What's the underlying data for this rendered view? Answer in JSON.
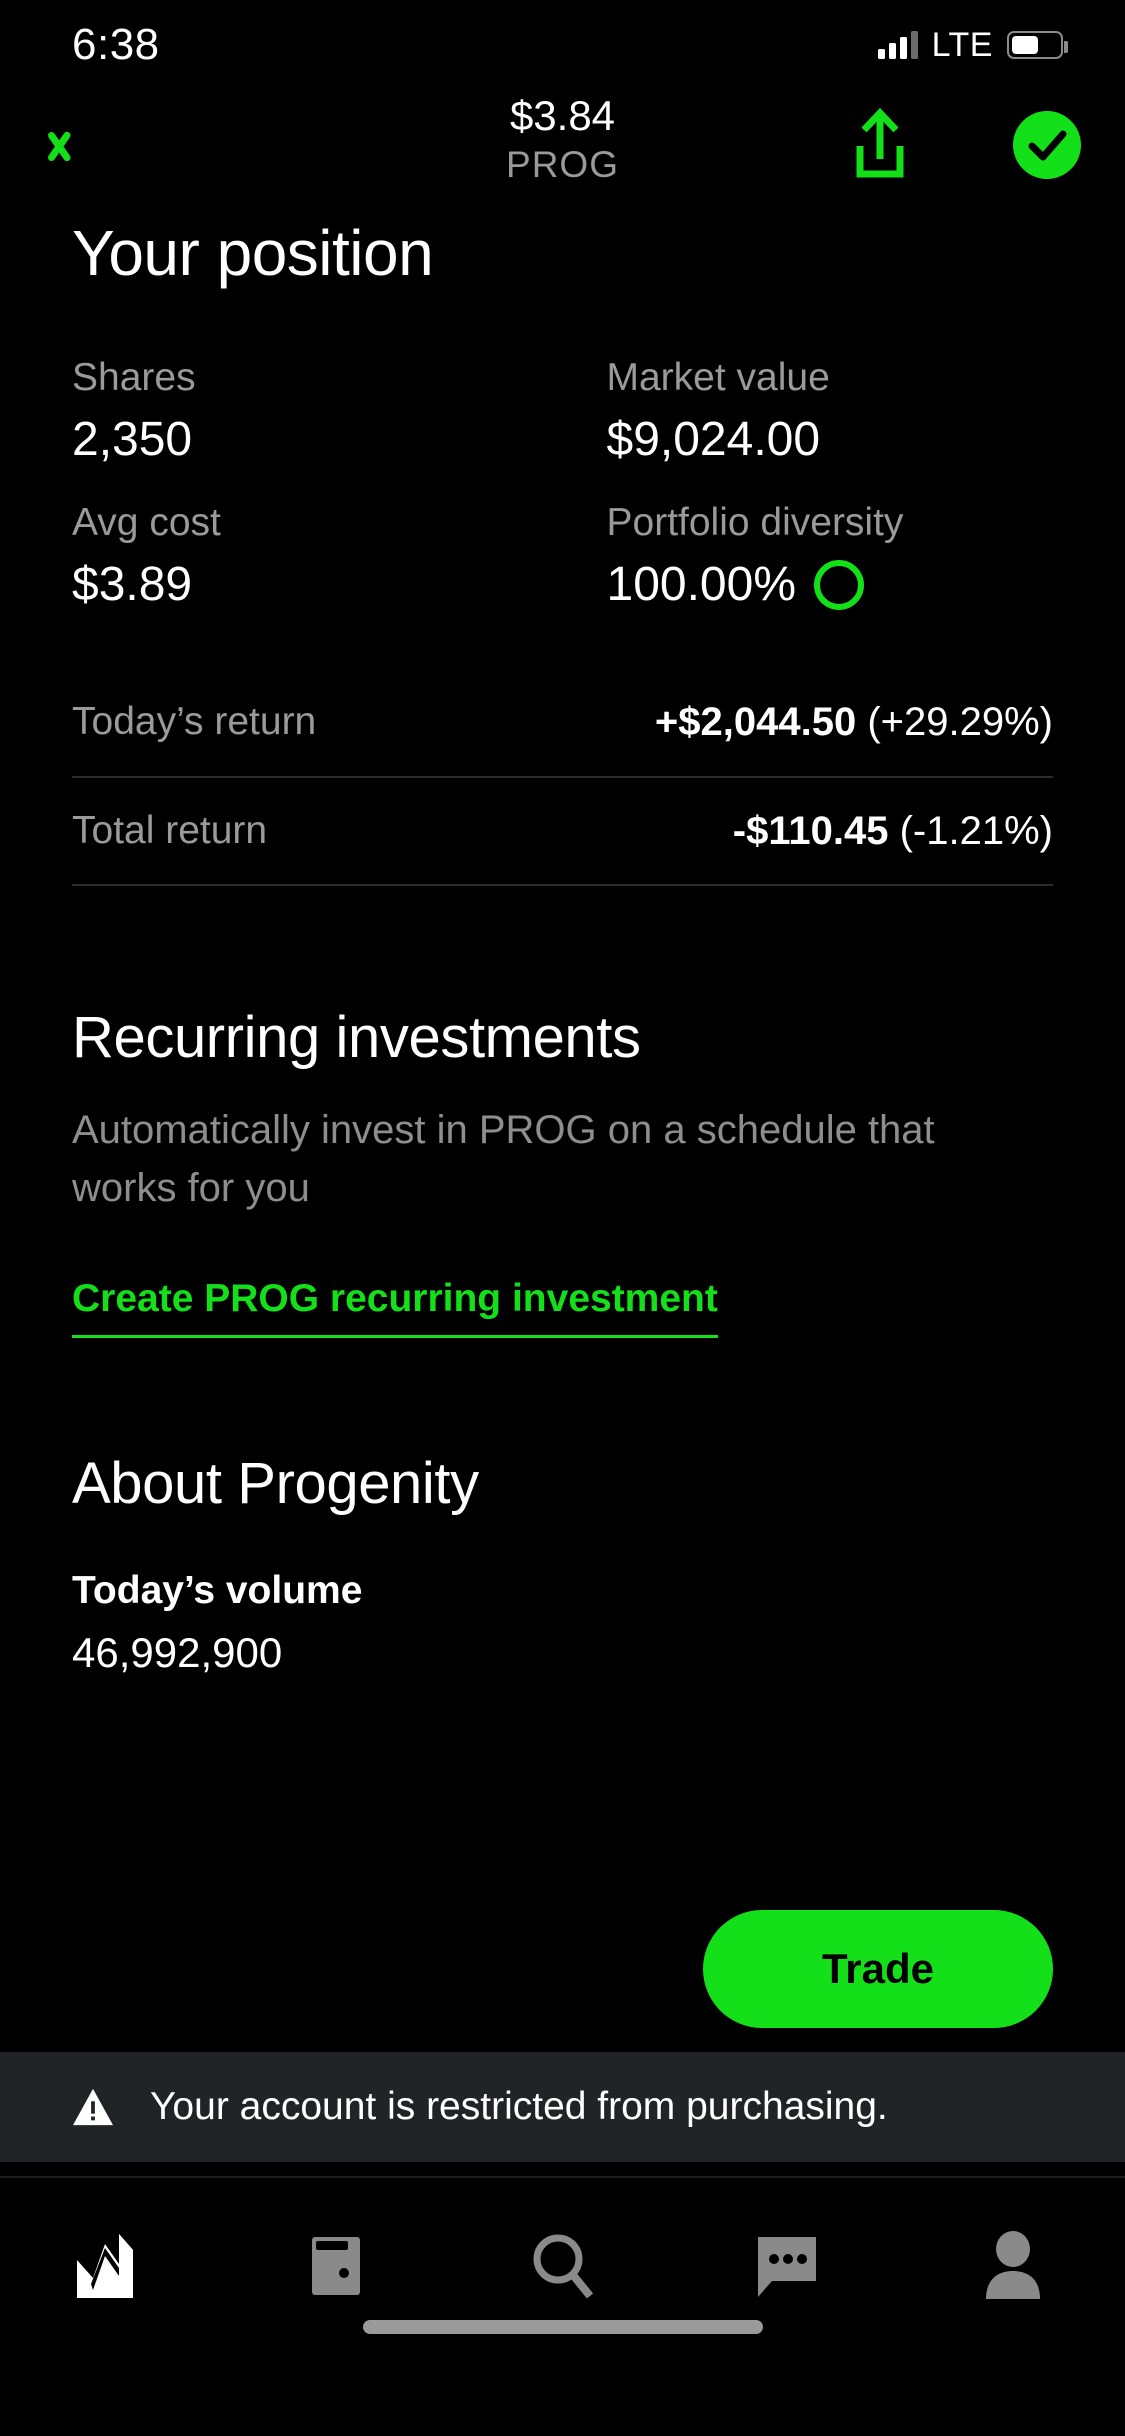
{
  "status_bar": {
    "time": "6:38",
    "network": "LTE",
    "signal_icon": "signal-bars-icon",
    "battery_icon": "battery-icon"
  },
  "nav_bar": {
    "back_icon": "chevron-left-icon",
    "price": "$3.84",
    "ticker": "PROG",
    "share_icon": "share-upload-icon",
    "status_icon": "check-circle-icon",
    "accent_color": "#14e01a"
  },
  "position": {
    "title": "Your position",
    "stats": [
      {
        "label": "Shares",
        "value": "2,350"
      },
      {
        "label": "Market value",
        "value": "$9,024.00"
      },
      {
        "label": "Avg cost",
        "value": "$3.89"
      },
      {
        "label": "Portfolio diversity",
        "value": "100.00%",
        "icon": "diversity-ring-icon"
      }
    ],
    "returns": [
      {
        "label": "Today’s return",
        "amount": "+$2,044.50",
        "percent": "(+29.29%)"
      },
      {
        "label": "Total return",
        "amount": "-$110.45",
        "percent": "(-1.21%)"
      }
    ]
  },
  "recurring": {
    "title": "Recurring investments",
    "description": "Automatically invest in PROG on a schedule that works for you",
    "link_label": "Create PROG recurring investment"
  },
  "about": {
    "title": "About Progenity",
    "volume_label": "Today’s volume",
    "volume_value": "46,992,900"
  },
  "trade_button": {
    "label": "Trade",
    "color": "#14e01a"
  },
  "banner": {
    "icon": "warning-triangle-icon",
    "text": "Your account is restricted from purchasing.",
    "background": "#202427"
  },
  "tab_bar": {
    "items": [
      {
        "name": "tab-investing",
        "icon": "stock-chart-icon",
        "active": true
      },
      {
        "name": "tab-wallet",
        "icon": "wallet-icon",
        "active": false
      },
      {
        "name": "tab-search",
        "icon": "search-icon",
        "active": false
      },
      {
        "name": "tab-notifications",
        "icon": "message-bubble-icon",
        "active": false
      },
      {
        "name": "tab-account",
        "icon": "person-icon",
        "active": false
      }
    ],
    "active_color": "#ffffff",
    "inactive_color": "#8a8a8a"
  }
}
